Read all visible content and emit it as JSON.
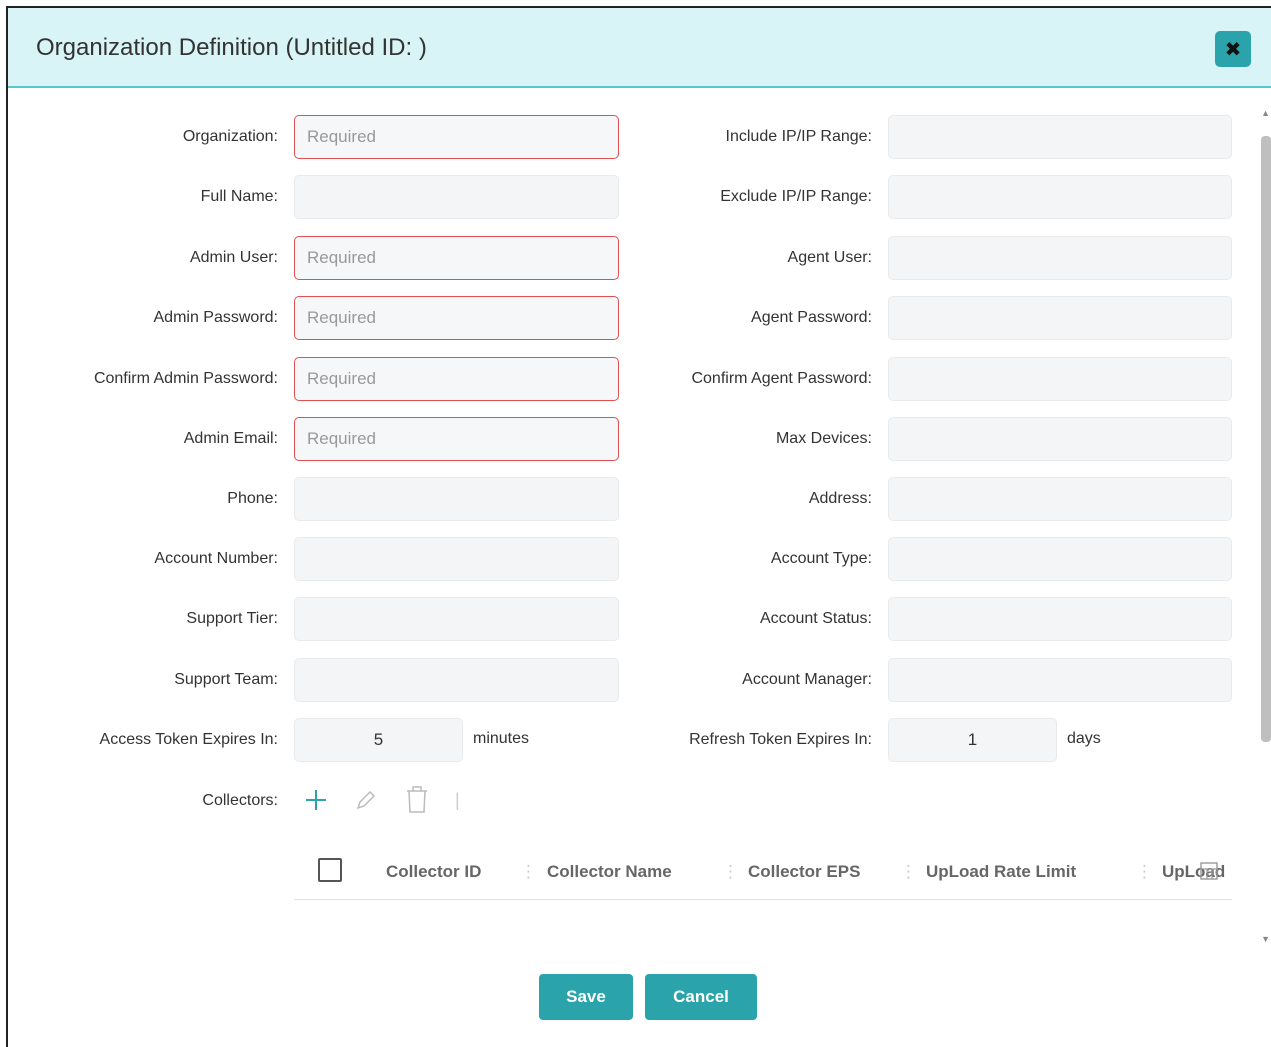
{
  "dialog": {
    "title": "Organization Definition (Untitled ID: )",
    "close_label": "✖"
  },
  "form": {
    "left": [
      {
        "label": "Organization:",
        "placeholder": "Required",
        "required": true
      },
      {
        "label": "Full Name:",
        "placeholder": "",
        "required": false
      },
      {
        "label": "Admin User:",
        "placeholder": "Required",
        "required": true
      },
      {
        "label": "Admin Password:",
        "placeholder": "Required",
        "required": true
      },
      {
        "label": "Confirm Admin Password:",
        "placeholder": "Required",
        "required": true
      },
      {
        "label": "Admin Email:",
        "placeholder": "Required",
        "required": true
      },
      {
        "label": "Phone:",
        "placeholder": "",
        "required": false
      },
      {
        "label": "Account Number:",
        "placeholder": "",
        "required": false
      },
      {
        "label": "Support Tier:",
        "placeholder": "",
        "required": false
      },
      {
        "label": "Support Team:",
        "placeholder": "",
        "required": false
      }
    ],
    "right": [
      {
        "label": "Include IP/IP Range:"
      },
      {
        "label": "Exclude IP/IP Range:"
      },
      {
        "label": "Agent User:"
      },
      {
        "label": "Agent Password:"
      },
      {
        "label": "Confirm Agent Password:"
      },
      {
        "label": "Max Devices:"
      },
      {
        "label": "Address:"
      },
      {
        "label": "Account Type:"
      },
      {
        "label": "Account Status:"
      },
      {
        "label": "Account Manager:"
      }
    ],
    "access_token": {
      "label": "Access Token Expires In:",
      "value": "5",
      "unit": "minutes"
    },
    "refresh_token": {
      "label": "Refresh Token Expires In:",
      "value": "1",
      "unit": "days"
    },
    "collectors": {
      "label": "Collectors:",
      "icons": [
        "add-icon",
        "edit-icon",
        "delete-icon"
      ],
      "columns": [
        "Collector ID",
        "Collector Name",
        "Collector EPS",
        "UpLoad Rate Limit",
        "UpLoad"
      ]
    }
  },
  "buttons": {
    "save": "Save",
    "cancel": "Cancel"
  },
  "colors": {
    "accent": "#2aa3ab",
    "header_bg": "#d8f4f6",
    "required_border": "#e05050"
  }
}
